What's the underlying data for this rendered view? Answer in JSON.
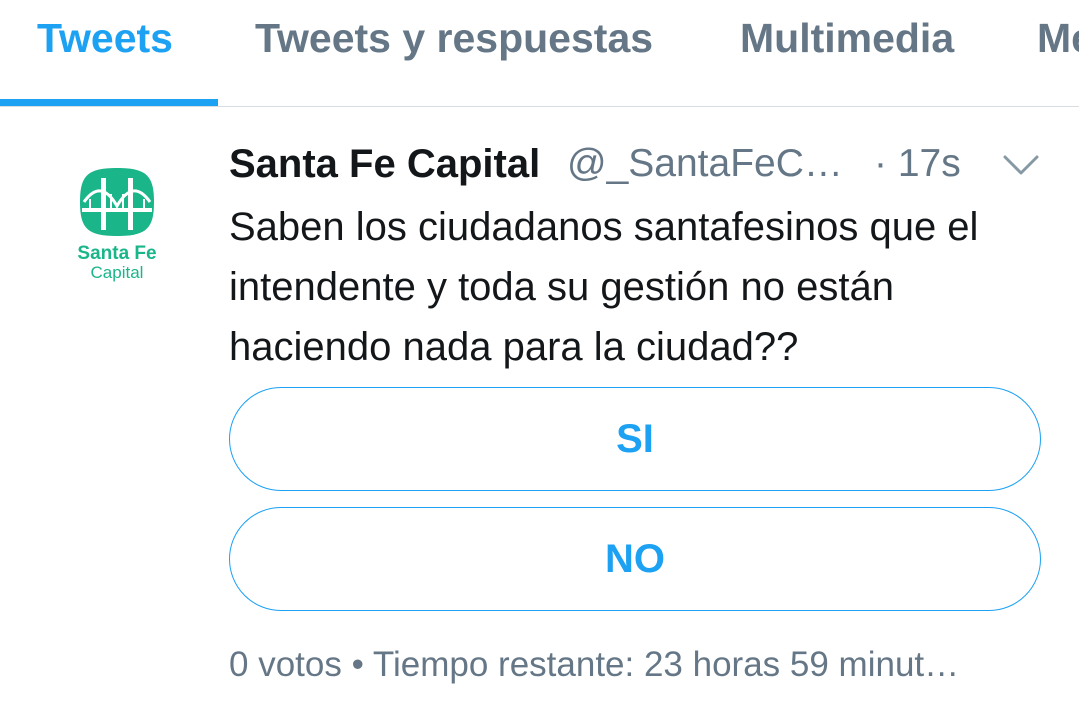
{
  "tabs": [
    {
      "label": "Tweets",
      "active": true
    },
    {
      "label": "Tweets y respuestas",
      "active": false
    },
    {
      "label": "Multimedia",
      "active": false
    },
    {
      "label": "Me",
      "active": false
    }
  ],
  "tweet": {
    "avatar": {
      "logo_line1": "Santa Fe",
      "logo_line2": "Capital",
      "brand_color": "#1bb58a"
    },
    "display_name": "Santa Fe Capital",
    "handle": "@_SantaFeC…",
    "time": "· 17s",
    "menu_icon": "chevron-down-icon",
    "text": "Saben los ciudadanos santafesinos que el intendente y toda su gestión no están haciendo nada para la ciudad??",
    "poll": {
      "options": [
        "SI",
        "NO"
      ],
      "meta": "0 votos • Tiempo restante: 23 horas 59 minut…"
    }
  },
  "colors": {
    "accent": "#1da1f2",
    "text_primary": "#14171a",
    "text_secondary": "#657786",
    "divider": "#d8dde1"
  }
}
